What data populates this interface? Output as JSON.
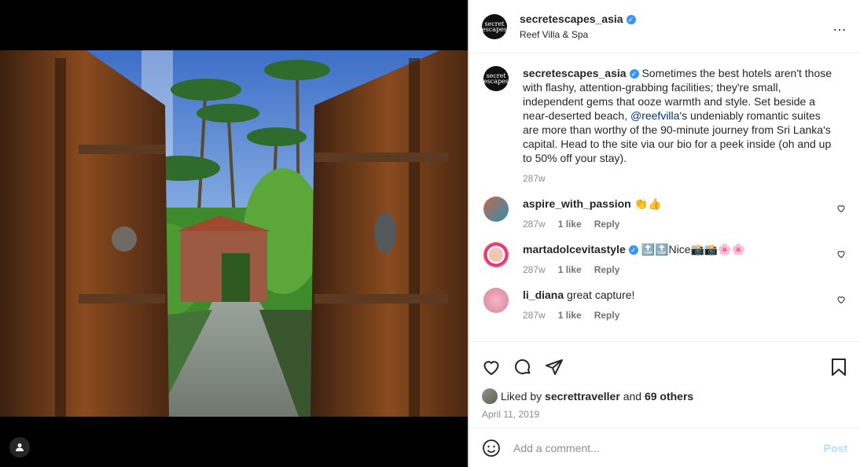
{
  "post": {
    "username": "secretescapes_asia",
    "location": "Reef Villa & Spa",
    "avatar_text": "secret escapes",
    "more_icon": "…",
    "caption": {
      "text_before_mention": "Sometimes the best hotels aren't those with flashy, attention-grabbing facilities; they're small, independent gems that ooze warmth and style. Set beside a near-deserted beach, ",
      "mention": "@reefvilla",
      "text_after_mention": "'s undeniably romantic suites are more than worthy of the 90-minute journey from Sri Lanka's capital. Head to the site via our bio for a peek inside (oh and up to 50% off your stay).",
      "time": "287w"
    }
  },
  "comments": [
    {
      "username": "aspire_with_passion",
      "text": "👏👍",
      "time": "287w",
      "likes": "1 like",
      "reply": "Reply"
    },
    {
      "username": "martadolcevitastyle",
      "text": "🔝🔝Nice📸📸🌸🌸",
      "time": "287w",
      "likes": "1 like",
      "reply": "Reply",
      "verified": true
    },
    {
      "username": "li_diana",
      "text": "great capture!",
      "time": "287w",
      "likes": "1 like",
      "reply": "Reply"
    }
  ],
  "likes": {
    "prefix": "Liked by",
    "user": "secrettraveller",
    "and": "and",
    "others": "69 others"
  },
  "date": "April 11, 2019",
  "composer": {
    "placeholder": "Add a comment...",
    "post_label": "Post"
  },
  "colors": {
    "verified": "#3897f0",
    "mention": "#00376b",
    "post_disabled": "#b2dffc"
  }
}
